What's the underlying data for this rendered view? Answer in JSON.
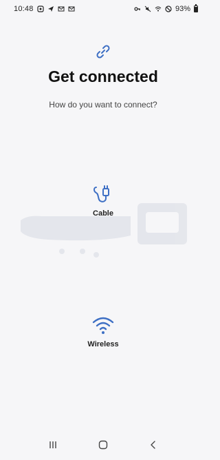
{
  "status_bar": {
    "time": "10:48",
    "battery_percent": "93%",
    "battery_level": 0.93,
    "left_icons": [
      "notification-icon",
      "send-icon",
      "mail-icon",
      "mail-icon-2"
    ],
    "right_icons": [
      "vpn-key-icon",
      "mute-icon",
      "wifi-icon",
      "do-not-disturb-icon"
    ]
  },
  "header": {
    "icon": "link-icon",
    "title": "Get connected",
    "subtitle": "How do you want to connect?"
  },
  "options": [
    {
      "icon": "cable-icon",
      "label": "Cable"
    },
    {
      "icon": "wifi-icon",
      "label": "Wireless"
    }
  ],
  "colors": {
    "accent": "#3d6fc4",
    "background": "#f6f6f8",
    "text_primary": "#111111",
    "text_secondary": "#444444"
  },
  "nav_bar": {
    "buttons": [
      "recents-icon",
      "home-icon",
      "back-icon"
    ]
  }
}
